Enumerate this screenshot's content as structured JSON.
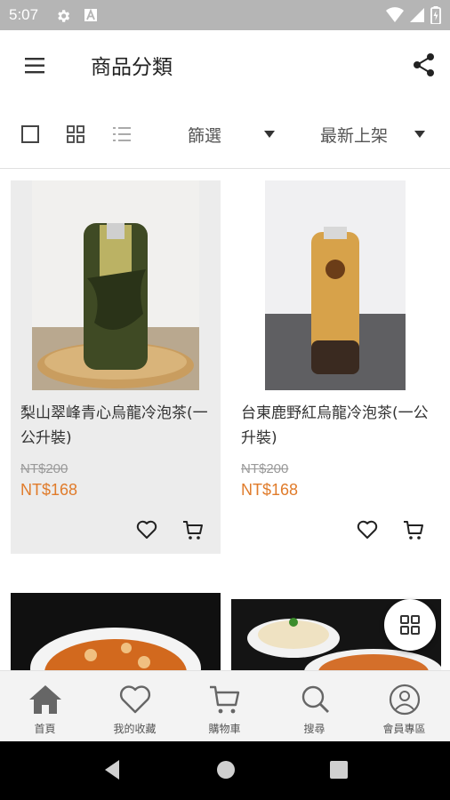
{
  "status_bar": {
    "time": "5:07",
    "icons": [
      "gear-icon",
      "app-a-icon",
      "wifi-icon",
      "signal-icon",
      "battery-icon"
    ]
  },
  "app_bar": {
    "title": "商品分類",
    "icons": [
      "menu-icon",
      "share-icon"
    ]
  },
  "toolbar": {
    "view_icons": [
      "single-view-icon",
      "grid-view-icon",
      "list-view-icon"
    ],
    "filter_label": "篩選",
    "sort_label": "最新上架"
  },
  "products": [
    {
      "name": "梨山翠峰青心烏龍冷泡茶(一公升裝)",
      "old_price": "NT$200",
      "price": "NT$168"
    },
    {
      "name": "台東鹿野紅烏龍冷泡茶(一公升裝)",
      "old_price": "NT$200",
      "price": "NT$168"
    }
  ],
  "bottom_nav": [
    {
      "label": "首頁",
      "icon": "home-icon"
    },
    {
      "label": "我的收藏",
      "icon": "heart-icon"
    },
    {
      "label": "購物車",
      "icon": "cart-icon"
    },
    {
      "label": "搜尋",
      "icon": "search-icon"
    },
    {
      "label": "會員專區",
      "icon": "user-icon"
    }
  ],
  "colors": {
    "price": "#e07b2a",
    "status_bar": "#b5b5b5",
    "active_card": "#ececec"
  }
}
